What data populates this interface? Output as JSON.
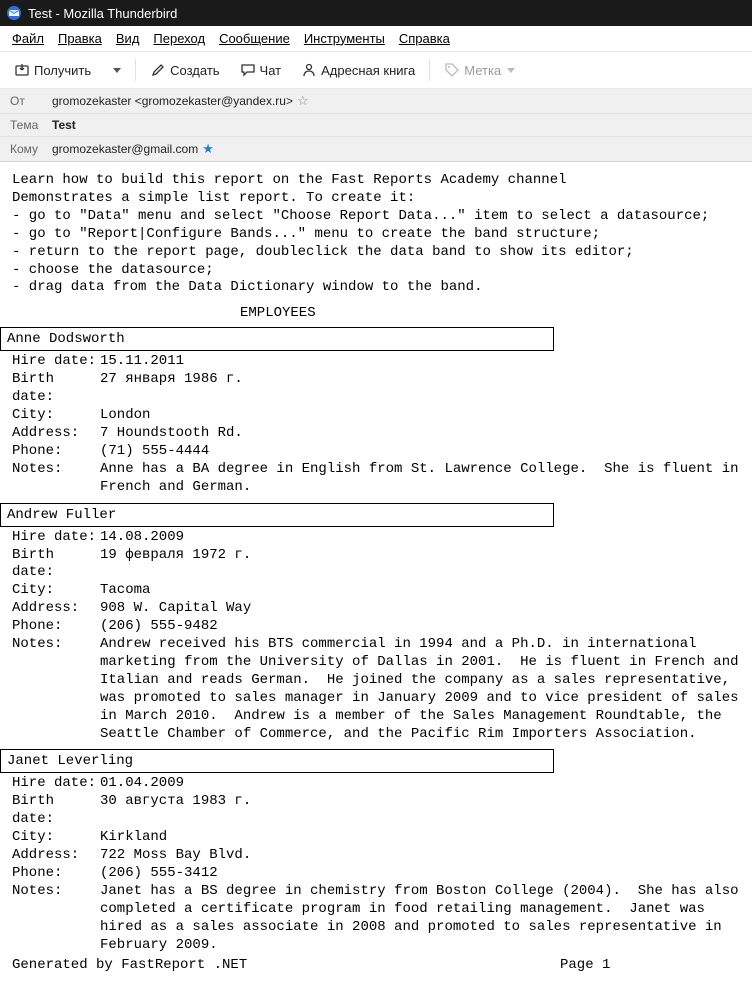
{
  "window": {
    "title": "Test - Mozilla Thunderbird"
  },
  "menu": {
    "file": "Файл",
    "edit": "Правка",
    "view": "Вид",
    "go": "Переход",
    "message": "Сообщение",
    "tools": "Инструменты",
    "help": "Справка"
  },
  "toolbar": {
    "get": "Получить",
    "write": "Создать",
    "chat": "Чат",
    "addressbook": "Адресная книга",
    "tag": "Метка"
  },
  "headers": {
    "from_label": "От",
    "from_value": "gromozekaster <gromozekaster@yandex.ru>",
    "subject_label": "Тема",
    "subject_value": "Test",
    "to_label": "Кому",
    "to_value": "gromozekaster@gmail.com"
  },
  "intro": "Learn how to build this report on the Fast Reports Academy channel\nDemonstrates a simple list report. To create it:\n- go to \"Data\" menu and select \"Choose Report Data...\" item to select a datasource;\n- go to \"Report|Configure Bands...\" menu to create the band structure;\n- return to the report page, doubleclick the data band to show its editor;\n- choose the datasource;\n- drag data from the Data Dictionary window to the band.",
  "report_title": "EMPLOYEES",
  "labels": {
    "hire": "Hire date:",
    "birth": "Birth date:",
    "city": "City:",
    "address": "Address:",
    "phone": "Phone:",
    "notes": "Notes:"
  },
  "employees": [
    {
      "name": "Anne Dodsworth",
      "hire": "15.11.2011",
      "birth": "27 января 1986 г.",
      "city": "London",
      "address": "7 Houndstooth Rd.",
      "phone": "(71) 555-4444",
      "notes": "Anne has a BA degree in English from St. Lawrence College.  She is fluent in French and German."
    },
    {
      "name": "Andrew Fuller",
      "hire": "14.08.2009",
      "birth": "19 февраля 1972 г.",
      "city": "Tacoma",
      "address": "908 W. Capital Way",
      "phone": "(206) 555-9482",
      "notes": "Andrew received his BTS commercial in 1994 and a Ph.D. in international marketing from the University of Dallas in 2001.  He is fluent in French and Italian and reads German.  He joined the company as a sales representative, was promoted to sales manager in January 2009 and to vice president of sales in March 2010.  Andrew is a member of the Sales Management Roundtable, the Seattle Chamber of Commerce, and the Pacific Rim Importers Association."
    },
    {
      "name": "Janet Leverling",
      "hire": "01.04.2009",
      "birth": "30 августа 1983 г.",
      "city": "Kirkland",
      "address": "722 Moss Bay Blvd.",
      "phone": "(206) 555-3412",
      "notes": "Janet has a BS degree in chemistry from Boston College (2004).  She has also completed a certificate program in food retailing management.  Janet was hired as a sales associate in 2008 and promoted to sales representative in February 2009."
    }
  ],
  "footer": {
    "generated": "Generated by FastReport .NET",
    "page": "Page 1"
  }
}
